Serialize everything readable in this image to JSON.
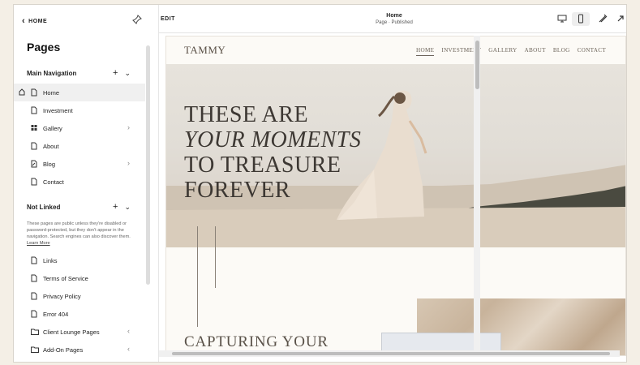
{
  "sidebar": {
    "back_label": "HOME",
    "title": "Pages",
    "main_nav": {
      "label": "Main Navigation",
      "add": "+",
      "collapse": "⌄",
      "items": [
        {
          "label": "Home"
        },
        {
          "label": "Investment"
        },
        {
          "label": "Gallery",
          "chevron": "›"
        },
        {
          "label": "About"
        },
        {
          "label": "Blog",
          "chevron": "›"
        },
        {
          "label": "Contact"
        }
      ]
    },
    "not_linked": {
      "label": "Not Linked",
      "add": "+",
      "collapse": "⌄",
      "note": "These pages are public unless they're disabled or password-protected, but they don't appear in the navigation. Search engines can also discover them.",
      "learn_more": "Learn More",
      "items": [
        {
          "label": "Links"
        },
        {
          "label": "Terms of Service"
        },
        {
          "label": "Privacy Policy"
        },
        {
          "label": "Error 404"
        },
        {
          "label": "Client Lounge Pages",
          "chevron": "‹"
        },
        {
          "label": "Add-On Pages",
          "chevron": "‹"
        }
      ]
    }
  },
  "topbar": {
    "edit_label": "EDIT",
    "page_title": "Home",
    "page_status": "Page · Published"
  },
  "site": {
    "logo": "TAMMY",
    "nav": [
      "HOME",
      "INVESTMENT",
      "GALLERY",
      "ABOUT",
      "BLOG",
      "CONTACT"
    ],
    "headline": [
      "THESE ARE",
      "YOUR MOMENTS",
      "TO TREASURE",
      "FOREVER"
    ],
    "subheading": "CAPTURING YOUR"
  },
  "colors": {
    "accent": "#3d3833",
    "nav_text": "#6d645a",
    "canvas_bg": "#fcfaf6"
  }
}
